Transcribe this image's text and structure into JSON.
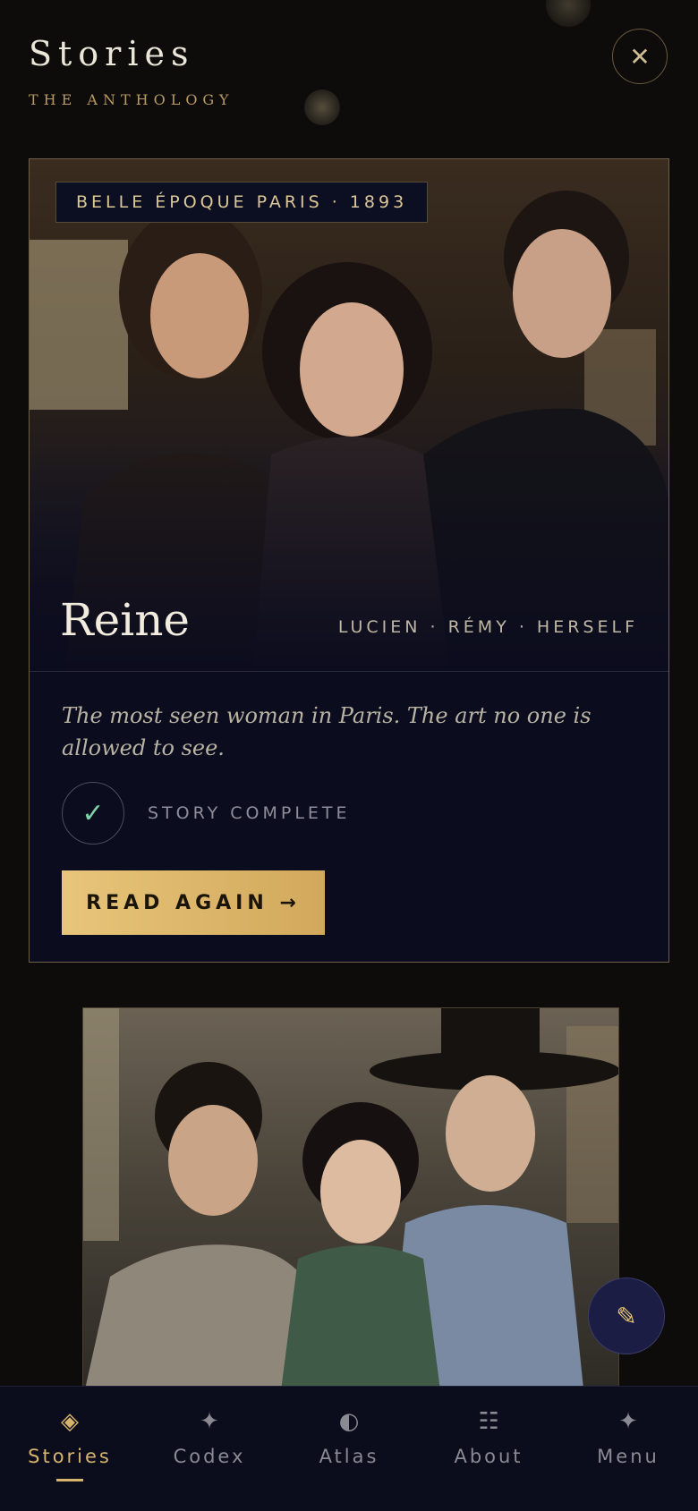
{
  "header": {
    "title": "Stories",
    "subtitle": "THE ANTHOLOGY",
    "close_icon": "close-icon"
  },
  "featured_story": {
    "tag": "BELLE ÉPOQUE PARIS · 1893",
    "name": "Reine",
    "characters": "LUCIEN · RÉMY · HERSELF",
    "description": "The most seen woman in Paris. The art no one is allowed to see.",
    "status_icon": "check-icon",
    "status": "STORY COMPLETE",
    "button_label": "READ AGAIN →"
  },
  "fab": {
    "icon": "pencil-icon",
    "glyph": "✎"
  },
  "nav": {
    "items": [
      {
        "icon": "◈",
        "label": "Stories",
        "active": true
      },
      {
        "icon": "✦",
        "label": "Codex"
      },
      {
        "icon": "◐",
        "label": "Atlas"
      },
      {
        "icon": "☷",
        "label": "About"
      },
      {
        "icon": "✦",
        "label": "Menu"
      }
    ]
  },
  "colors": {
    "accent": "#d7b46c",
    "background": "#0d0c0b",
    "card": "#0b0c1e",
    "check": "#7bd3a7"
  }
}
